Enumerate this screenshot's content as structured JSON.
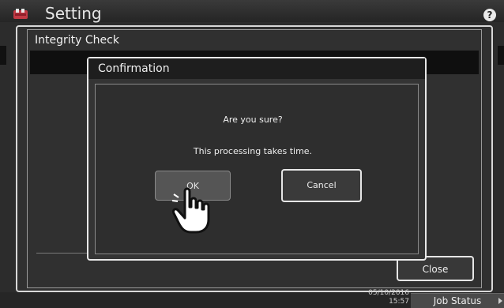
{
  "app": {
    "title": "Setting",
    "help_icon": "question-icon",
    "help_label": "?"
  },
  "panel": {
    "title": "Integrity Check",
    "close_label": "Close"
  },
  "dialog": {
    "title": "Confirmation",
    "messages": [
      "Are you sure?",
      "This processing takes time."
    ],
    "ok_label": "OK",
    "cancel_label": "Cancel"
  },
  "footer": {
    "date": "05/10/2016",
    "time": "15:57",
    "job_status_label": "Job Status"
  },
  "colors": {
    "background": "#2c2c2c",
    "button_pressed": "#555555",
    "border_highlight": "#e6e6e6"
  }
}
